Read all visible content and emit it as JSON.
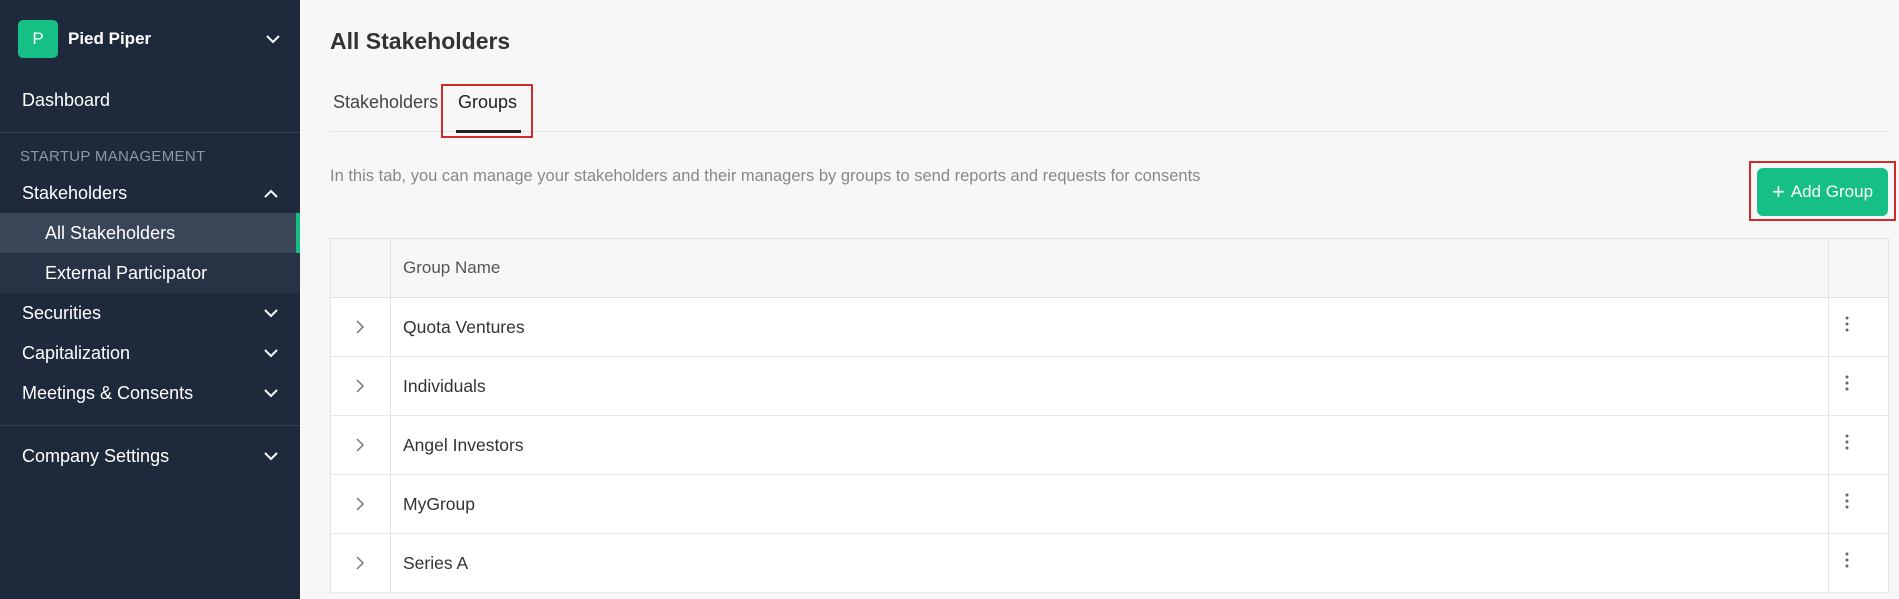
{
  "sidebar": {
    "brand": {
      "initial": "P",
      "name": "Pied Piper"
    },
    "dashboard": "Dashboard",
    "section_label": "STARTUP MANAGEMENT",
    "stakeholders": "Stakeholders",
    "sub_items": [
      "All Stakeholders",
      "External Participator"
    ],
    "securities": "Securities",
    "capitalization": "Capitalization",
    "meetings": "Meetings & Consents",
    "company_settings": "Company Settings"
  },
  "main": {
    "title": "All Stakeholders",
    "tabs": [
      "Stakeholders",
      "Groups"
    ],
    "active_tab": "Groups",
    "description": "In this tab, you can manage your stakeholders and their managers by groups to send reports and requests for consents",
    "add_button": {
      "icon": "+",
      "label": "Add Group"
    },
    "table": {
      "header": "Group Name",
      "rows": [
        "Quota Ventures",
        "Individuals",
        "Angel Investors",
        "MyGroup",
        "Series A"
      ]
    }
  },
  "colors": {
    "sidebar_bg": "#1e2a3b",
    "accent": "#16c085",
    "highlight": "#d52a2a"
  },
  "icons": {
    "chevron": "chevron-icon",
    "expand": "chevron-right-icon",
    "menu": "kebab-menu-icon"
  }
}
